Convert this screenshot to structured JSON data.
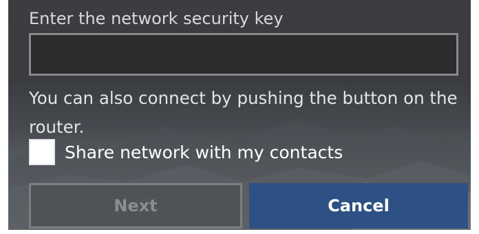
{
  "dialog": {
    "key_label": "Enter the network security key",
    "key_value": "",
    "hint": "You can also connect by pushing the button on the router.",
    "share": {
      "label": "Share network with my contacts",
      "checked": false
    },
    "buttons": {
      "next": "Next",
      "cancel": "Cancel"
    }
  },
  "colors": {
    "cancel_bg": "#2d5184",
    "next_disabled_text": "#8a8d91",
    "background": "#3b3d41"
  }
}
